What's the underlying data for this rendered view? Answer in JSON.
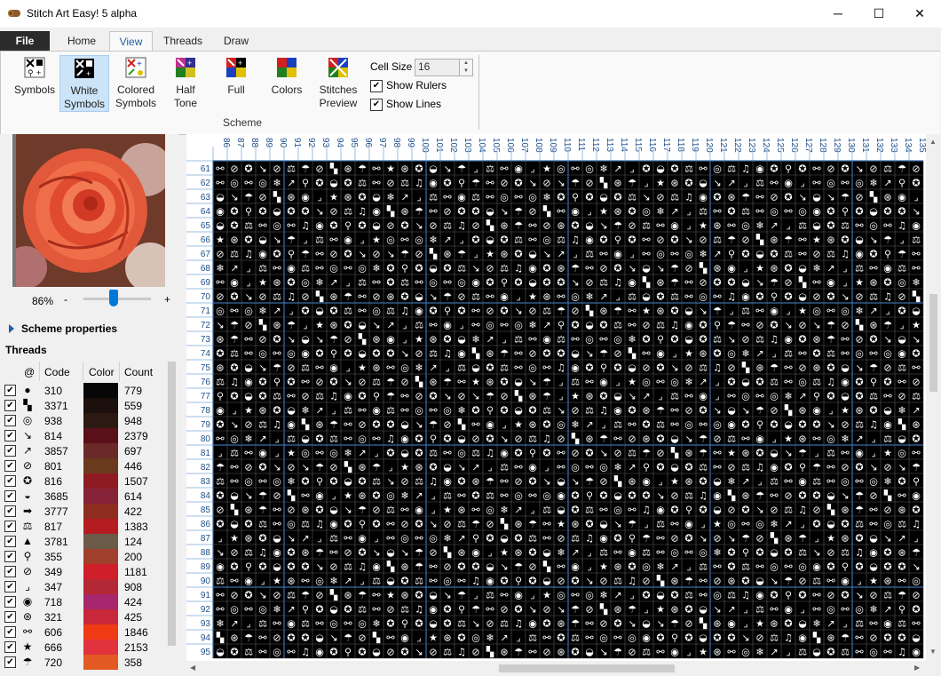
{
  "window": {
    "title": "Stitch Art Easy! 5 alpha",
    "controls": {
      "minimize": "─",
      "maximize": "☐",
      "close": "✕"
    }
  },
  "menu_tabs": [
    {
      "label": "File"
    },
    {
      "label": "Home"
    },
    {
      "label": "View",
      "active": true
    },
    {
      "label": "Threads"
    },
    {
      "label": "Draw"
    }
  ],
  "ribbon": {
    "buttons": [
      {
        "label": "Symbols",
        "icon": "symbols-icon"
      },
      {
        "label": "White\nSymbols",
        "icon": "white-symbols-icon",
        "selected": true
      },
      {
        "label": "Colored\nSymbols",
        "icon": "colored-symbols-icon"
      },
      {
        "label": "Half\nTone",
        "icon": "half-tone-icon"
      },
      {
        "label": "Full",
        "icon": "full-icon"
      },
      {
        "label": "Colors",
        "icon": "colors-icon"
      },
      {
        "label": "Stitches\nPreview",
        "icon": "stitches-preview-icon"
      }
    ],
    "group_label": "Scheme",
    "cell_size_label": "Cell Size",
    "cell_size_value": "16",
    "show_rulers_label": "Show Rulers",
    "show_rulers_checked": true,
    "show_lines_label": "Show Lines",
    "show_lines_checked": true
  },
  "left_panel": {
    "zoom": "86%",
    "zoom_minus": "-",
    "zoom_plus": "+",
    "zoom_fraction": 0.45,
    "scheme_properties_label": "Scheme properties",
    "threads_title": "Threads",
    "columns": {
      "symbol": "@",
      "code": "Code",
      "color": "Color",
      "count": "Count"
    },
    "threads": [
      {
        "sym": "●",
        "code": "310",
        "color": "#070707",
        "count": "779"
      },
      {
        "sym": "▚",
        "code": "3371",
        "color": "#1c100c",
        "count": "559"
      },
      {
        "sym": "◎",
        "code": "938",
        "color": "#2c1a12",
        "count": "948"
      },
      {
        "sym": "↘",
        "code": "814",
        "color": "#5a1019",
        "count": "2379"
      },
      {
        "sym": "↗",
        "code": "3857",
        "color": "#6a2a28",
        "count": "697"
      },
      {
        "sym": "⊘",
        "code": "801",
        "color": "#6a3a1e",
        "count": "446"
      },
      {
        "sym": "✪",
        "code": "816",
        "color": "#8e1a22",
        "count": "1507"
      },
      {
        "sym": "◒",
        "code": "3685",
        "color": "#862238",
        "count": "614"
      },
      {
        "sym": "➡",
        "code": "3777",
        "color": "#8e2c20",
        "count": "422"
      },
      {
        "sym": "⚖",
        "code": "817",
        "color": "#b41c22",
        "count": "1383"
      },
      {
        "sym": "▲",
        "code": "3781",
        "color": "#6c5a48",
        "count": "124"
      },
      {
        "sym": "⚲",
        "code": "355",
        "color": "#a0402c",
        "count": "200"
      },
      {
        "sym": "⊘",
        "code": "349",
        "color": "#d01e2a",
        "count": "1181"
      },
      {
        "sym": "⌟",
        "code": "347",
        "color": "#b42836",
        "count": "908"
      },
      {
        "sym": "◉",
        "code": "718",
        "color": "#a8266e",
        "count": "424"
      },
      {
        "sym": "⊛",
        "code": "321",
        "color": "#c8283a",
        "count": "425"
      },
      {
        "sym": "⚯",
        "code": "606",
        "color": "#f03a14",
        "count": "1846"
      },
      {
        "sym": "★",
        "code": "666",
        "color": "#e2323e",
        "count": "2153"
      },
      {
        "sym": "☂",
        "code": "720",
        "color": "#e25a22",
        "count": "358"
      }
    ]
  },
  "grid": {
    "col_start": 86,
    "col_end": 135,
    "row_start": 61,
    "row_end": 95,
    "symbols": [
      "⚯",
      "✪",
      "⌟",
      "⊘",
      "⚖",
      "★",
      "✪",
      "⚯",
      "⊛",
      "↘",
      "◎",
      "✪",
      "⊘",
      "⚯",
      "◒",
      "⚖",
      "◎",
      "↘",
      "♫",
      "❄",
      "☂",
      "◉",
      "↗",
      "⊘",
      "✪",
      "⌟",
      "▚",
      "⚲",
      "⚖",
      "⊛",
      "✪",
      "⚯",
      "☂",
      "◒",
      "◉"
    ],
    "major_every": 10
  }
}
